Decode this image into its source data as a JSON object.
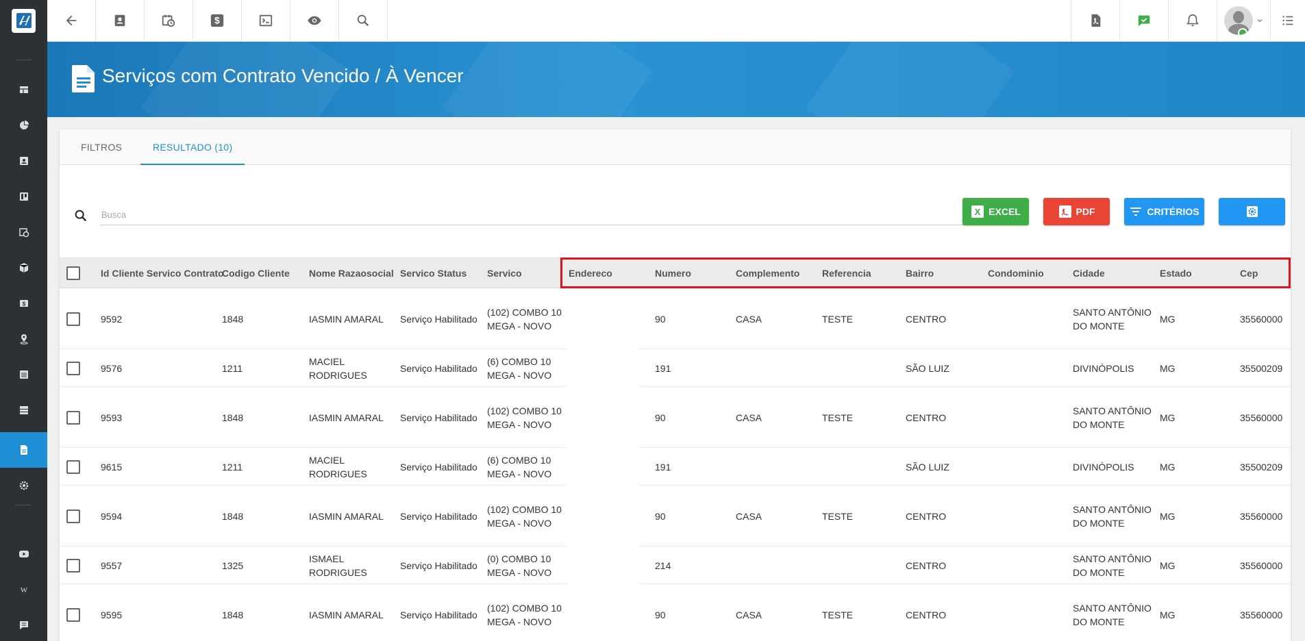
{
  "page": {
    "title": "Serviços com Contrato Vencido / À Vencer"
  },
  "sidebar": {
    "items": [
      {
        "icon": "dashboard-icon"
      },
      {
        "icon": "pie-chart-icon"
      },
      {
        "icon": "contact-card-icon"
      },
      {
        "icon": "board-icon"
      },
      {
        "icon": "calendar-clock-icon"
      },
      {
        "icon": "box-icon"
      },
      {
        "icon": "money-icon"
      },
      {
        "icon": "map-pin-icon"
      },
      {
        "icon": "list-icon"
      },
      {
        "icon": "server-icon"
      },
      {
        "icon": "document-icon"
      },
      {
        "icon": "gear-icon"
      },
      {
        "icon": "youtube-icon"
      },
      {
        "icon": "wiki-icon"
      },
      {
        "icon": "chat-icon"
      }
    ],
    "active_index": 10
  },
  "topbar": {
    "left_icons": [
      "back-arrow-icon",
      "contact-card-icon",
      "calendar-clock-icon",
      "dollar-icon",
      "terminal-icon",
      "eye-icon",
      "search-icon"
    ],
    "right_icons": [
      "pdf-icon",
      "check-chat-icon",
      "bell-icon",
      "avatar",
      "menu-list-icon"
    ]
  },
  "tabs": [
    {
      "label": "FILTROS"
    },
    {
      "label": "RESULTADO (10)"
    }
  ],
  "search": {
    "placeholder": "Busca",
    "value": ""
  },
  "actions": {
    "excel": "EXCEL",
    "pdf": "PDF",
    "criterios": "CRITÉRIOS"
  },
  "colors": {
    "accent": "#1e8fd5",
    "excel": "#3fae49",
    "pdf": "#ea4436",
    "highlight": "#e0141d"
  },
  "table": {
    "columns": [
      "Id Cliente Servico Contrato",
      "Codigo Cliente",
      "Nome Razaosocial",
      "Servico Status",
      "Servico",
      "Endereco",
      "Numero",
      "Complemento",
      "Referencia",
      "Bairro",
      "Condominio",
      "Cidade",
      "Estado",
      "Cep"
    ],
    "rows": [
      {
        "id": "9592",
        "codigo": "1848",
        "nome": "IASMIN AMARAL",
        "status": "Serviço Habilitado",
        "servico": "(102) COMBO 10 MEGA - NOVO",
        "endereco": "",
        "numero": "90",
        "complemento": "CASA",
        "referencia": "TESTE",
        "bairro": "CENTRO",
        "condominio": "",
        "cidade": "SANTO ANTÔNIO DO MONTE",
        "estado": "MG",
        "cep": "35560000"
      },
      {
        "id": "9576",
        "codigo": "1211",
        "nome": "MACIEL RODRIGUES",
        "status": "Serviço Habilitado",
        "servico": "(6) COMBO 10 MEGA - NOVO",
        "endereco": "",
        "numero": "191",
        "complemento": "",
        "referencia": "",
        "bairro": "SÃO LUIZ",
        "condominio": "",
        "cidade": "DIVINÓPOLIS",
        "estado": "MG",
        "cep": "35500209"
      },
      {
        "id": "9593",
        "codigo": "1848",
        "nome": "IASMIN AMARAL",
        "status": "Serviço Habilitado",
        "servico": "(102) COMBO 10 MEGA - NOVO",
        "endereco": "",
        "numero": "90",
        "complemento": "CASA",
        "referencia": "TESTE",
        "bairro": "CENTRO",
        "condominio": "",
        "cidade": "SANTO ANTÔNIO DO MONTE",
        "estado": "MG",
        "cep": "35560000"
      },
      {
        "id": "9615",
        "codigo": "1211",
        "nome": "MACIEL RODRIGUES",
        "status": "Serviço Habilitado",
        "servico": "(6) COMBO 10 MEGA - NOVO",
        "endereco": "",
        "numero": "191",
        "complemento": "",
        "referencia": "",
        "bairro": "SÃO LUIZ",
        "condominio": "",
        "cidade": "DIVINÓPOLIS",
        "estado": "MG",
        "cep": "35500209"
      },
      {
        "id": "9594",
        "codigo": "1848",
        "nome": "IASMIN AMARAL",
        "status": "Serviço Habilitado",
        "servico": "(102) COMBO 10 MEGA - NOVO",
        "endereco": "",
        "numero": "90",
        "complemento": "CASA",
        "referencia": "TESTE",
        "bairro": "CENTRO",
        "condominio": "",
        "cidade": "SANTO ANTÔNIO DO MONTE",
        "estado": "MG",
        "cep": "35560000"
      },
      {
        "id": "9557",
        "codigo": "1325",
        "nome": "ISMAEL RODRIGUES",
        "status": "Serviço Habilitado",
        "servico": "(0) COMBO 10 MEGA - NOVO",
        "endereco": "",
        "numero": "214",
        "complemento": "",
        "referencia": "",
        "bairro": "CENTRO",
        "condominio": "",
        "cidade": "SANTO ANTÔNIO DO MONTE",
        "estado": "MG",
        "cep": "35560000"
      },
      {
        "id": "9595",
        "codigo": "1848",
        "nome": "IASMIN AMARAL",
        "status": "Serviço Habilitado",
        "servico": "(102) COMBO 10 MEGA - NOVO",
        "endereco": "",
        "numero": "90",
        "complemento": "CASA",
        "referencia": "TESTE",
        "bairro": "CENTRO",
        "condominio": "",
        "cidade": "SANTO ANTÔNIO DO MONTE",
        "estado": "MG",
        "cep": "35560000"
      }
    ]
  }
}
